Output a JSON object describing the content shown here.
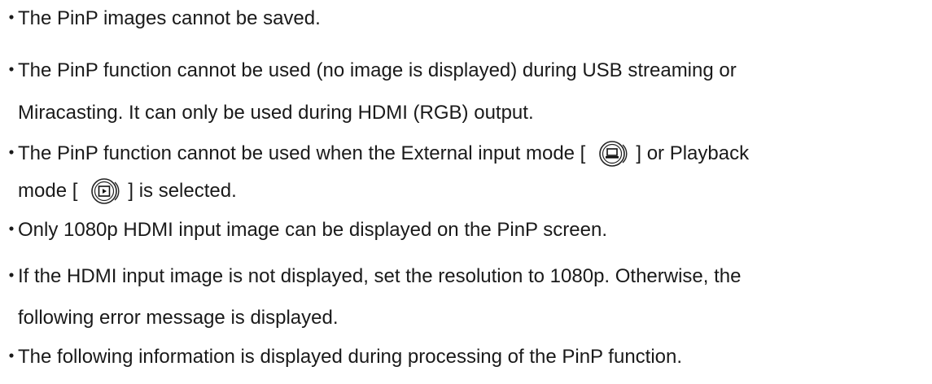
{
  "notes": {
    "bullet": "・",
    "item1": "The PinP images cannot be saved.",
    "item2_line1": "The PinP function cannot be used (no image is displayed) during USB streaming or",
    "item2_line2": "Miracasting. It can only be used during HDMI (RGB) output.",
    "item3_part1": "The PinP function cannot be used when the External input mode [",
    "item3_part2": "] or Playback",
    "item3_part3": "mode [",
    "item3_part4": "] is selected.",
    "item4": "Only 1080p HDMI input image can be displayed on the PinP screen.",
    "item5_line1": "If the HDMI input image is not displayed, set the resolution to 1080p. Otherwise, the",
    "item5_line2": "following error message is displayed.",
    "item6": "The following information is displayed during processing of the PinP function."
  },
  "icons": {
    "external_input": "external-input-mode-icon",
    "playback": "playback-mode-icon"
  }
}
